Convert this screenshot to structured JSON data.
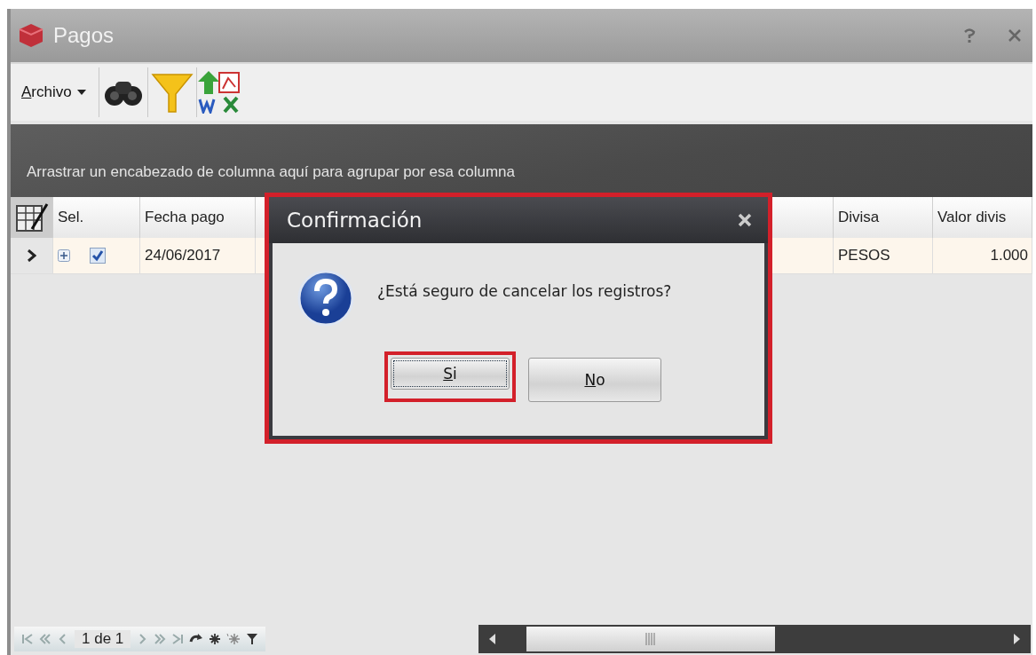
{
  "window": {
    "title": "Pagos"
  },
  "toolbar": {
    "menu": "Archivo"
  },
  "group_panel": {
    "text": "Arrastrar un encabezado de columna aquí para agrupar por esa columna"
  },
  "table": {
    "columns": [
      {
        "label": "Sel."
      },
      {
        "label": "Fecha pago"
      },
      {
        "label": "Divisa"
      },
      {
        "label": "Valor divis"
      }
    ],
    "rows": [
      {
        "selected": true,
        "checked": true,
        "expanded": false,
        "fecha": "24/06/2017",
        "divisa": "PESOS",
        "valor": "1.000"
      }
    ]
  },
  "pager": {
    "text": "1 de 1"
  },
  "dialog": {
    "title": "Confirmación",
    "message": "¿Está seguro de cancelar los registros?",
    "buttons": [
      {
        "label": "Si",
        "focused": true
      },
      {
        "label": "No",
        "focused": false
      }
    ]
  }
}
